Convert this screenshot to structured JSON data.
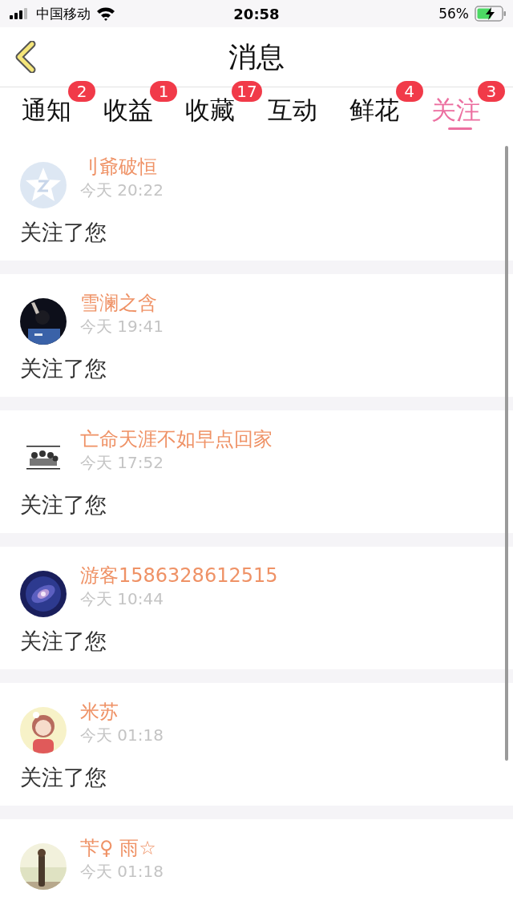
{
  "status_bar": {
    "carrier": "中国移动",
    "time": "20:58",
    "battery": "56%"
  },
  "nav": {
    "title": "消息"
  },
  "tabs": [
    {
      "label": "通知",
      "badge": "2",
      "selected": false
    },
    {
      "label": "收益",
      "badge": "1",
      "selected": false
    },
    {
      "label": "收藏",
      "badge": "17",
      "selected": false
    },
    {
      "label": "互动",
      "selected": false
    },
    {
      "label": "鲜花",
      "badge": "4",
      "selected": false
    },
    {
      "label": "关注",
      "badge": "3",
      "selected": true
    }
  ],
  "messages": [
    {
      "avatar": {
        "kind": "icon"
      },
      "name": "刂爺破恒",
      "time": "今天 20:22",
      "text": "关注了您"
    },
    {
      "name": "雪澜之含",
      "time": "今天 19:41",
      "text": "关注了您"
    },
    {
      "name": "亡命天涯不如早点回家",
      "time": "今天 17:52",
      "text": "关注了您"
    },
    {
      "name": "游客1586328612515",
      "time": "今天 10:44",
      "text": "关注了您"
    },
    {
      "name": "米苏",
      "time": "今天 01:18",
      "text": "关注了您"
    },
    {
      "name": "苄♀ 雨☆",
      "time": "今天 01:18"
    }
  ]
}
